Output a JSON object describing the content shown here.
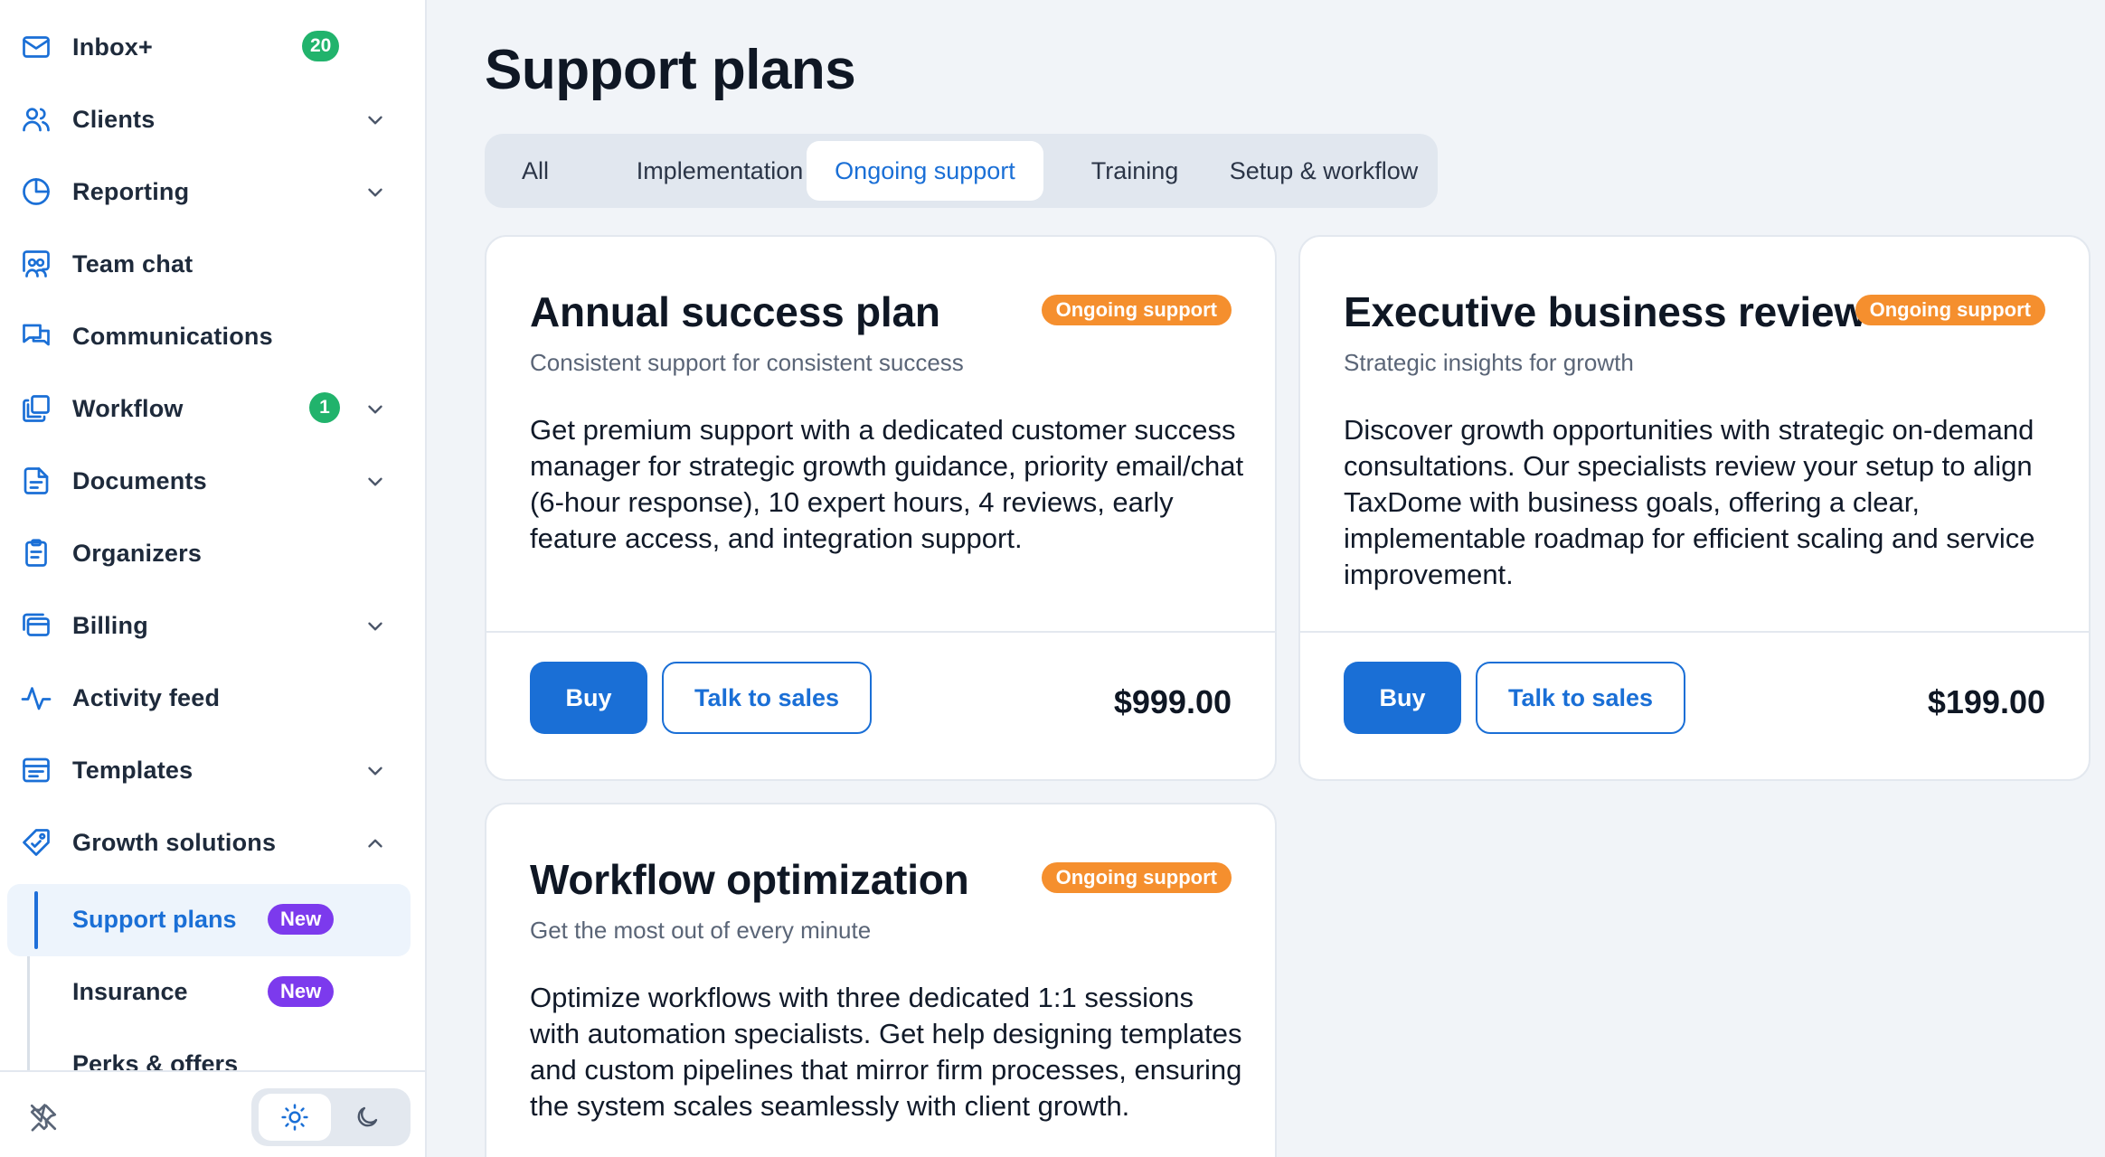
{
  "sidebar": {
    "items": [
      {
        "label": "Inbox+",
        "badge": "20"
      },
      {
        "label": "Clients"
      },
      {
        "label": "Reporting"
      },
      {
        "label": "Team chat"
      },
      {
        "label": "Communications"
      },
      {
        "label": "Workflow",
        "badge": "1"
      },
      {
        "label": "Documents"
      },
      {
        "label": "Organizers"
      },
      {
        "label": "Billing"
      },
      {
        "label": "Activity feed"
      },
      {
        "label": "Templates"
      },
      {
        "label": "Growth solutions"
      }
    ],
    "sub_items": [
      {
        "label": "Support plans",
        "badge": "New"
      },
      {
        "label": "Insurance",
        "badge": "New"
      },
      {
        "label": "Perks & offers"
      }
    ]
  },
  "main": {
    "title": "Support plans",
    "tabs": [
      "All",
      "Implementation",
      "Ongoing support",
      "Training",
      "Setup & workflow"
    ],
    "active_tab": "Ongoing support",
    "cards": [
      {
        "title": "Annual success plan",
        "badge": "Ongoing support",
        "subtitle": "Consistent support for consistent success",
        "description": "Get premium support with a dedicated customer success manager for strategic growth guidance, priority email/chat (6-hour response), 10 expert hours, 4 reviews, early feature access, and integration support.",
        "buy_label": "Buy",
        "talk_label": "Talk to sales",
        "price": "$999.00"
      },
      {
        "title": "Executive business review",
        "badge": "Ongoing support",
        "subtitle": "Strategic insights for growth",
        "description": "Discover growth opportunities with strategic on-demand consultations. Our specialists review your setup to align TaxDome with business goals, offering a clear, implementable roadmap for efficient scaling and service improvement.",
        "buy_label": "Buy",
        "talk_label": "Talk to sales",
        "price": "$199.00"
      },
      {
        "title": "Workflow optimization",
        "badge": "Ongoing support",
        "subtitle": "Get the most out of every minute",
        "description": "Optimize workflows with three dedicated 1:1 sessions with automation specialists. Get help designing templates and custom pipelines that mirror firm processes, ensuring the system scales seamlessly with client growth."
      }
    ]
  },
  "colors": {
    "accent": "#1a6fd6",
    "badge_green": "#21b36c",
    "badge_orange": "#f58f2e",
    "badge_purple": "#7c3aed"
  }
}
